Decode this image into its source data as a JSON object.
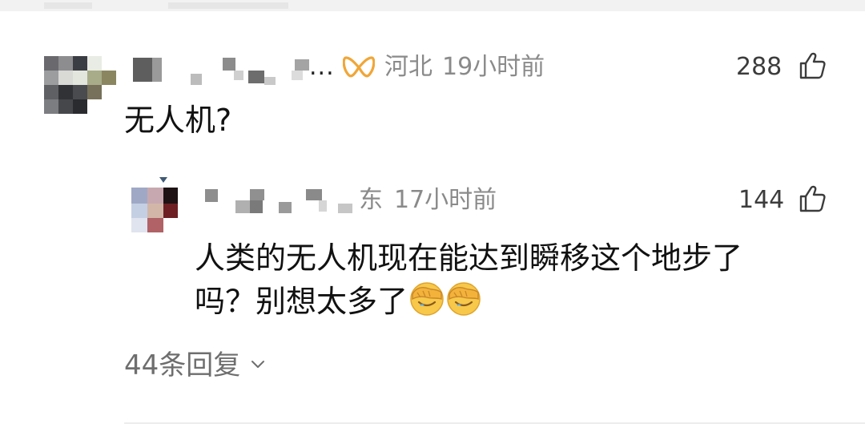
{
  "comment": {
    "name_suffix": "...",
    "location": "河北",
    "time": "19小时前",
    "likes": "288",
    "text": "无人机?",
    "vip_icon": "vip-badge-icon",
    "like_icon": "thumbs-up-icon"
  },
  "reply": {
    "location": "东",
    "time": "17小时前",
    "likes": "144",
    "text_line1": "人类的无人机现在能达到瞬移这个地步了",
    "text_line2": "吗？别想太多了",
    "emojis": [
      "facepalm-emoji",
      "facepalm-emoji"
    ],
    "like_icon": "thumbs-up-icon"
  },
  "replies_link": {
    "label": "44条回复",
    "icon": "chevron-down-icon"
  },
  "colors": {
    "meta_gray": "#8a8a8a",
    "text_dark": "#111111",
    "vip_orange": "#f0a637",
    "link_gray": "#6e6e6e"
  }
}
